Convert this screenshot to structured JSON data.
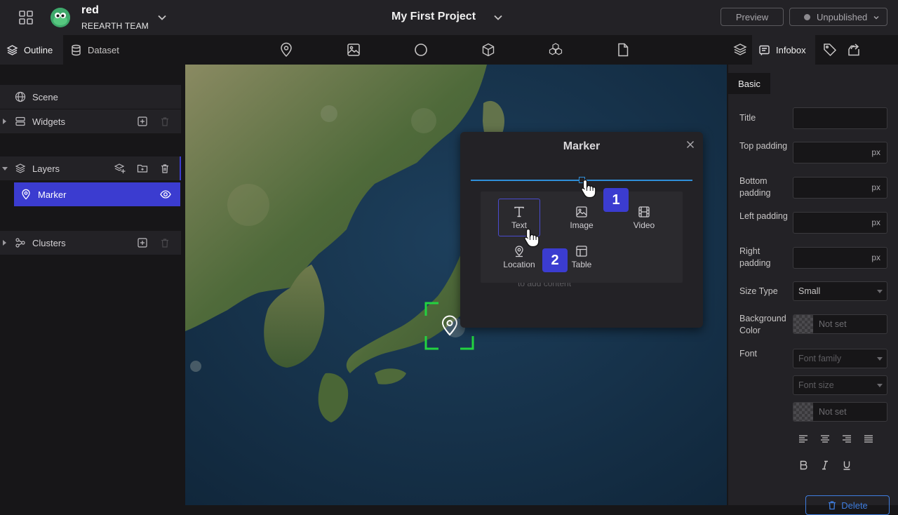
{
  "workspace": {
    "name": "red",
    "team": "REEARTH TEAM"
  },
  "project": {
    "title": "My First Project"
  },
  "header": {
    "preview_label": "Preview",
    "publish_status": "Unpublished"
  },
  "left_tabs": {
    "outline": "Outline",
    "dataset": "Dataset"
  },
  "toolbar": {
    "tools": [
      "marker-icon",
      "image-icon",
      "sphere-icon",
      "polygon-icon",
      "model-icon",
      "file-icon"
    ]
  },
  "right_tabs": {
    "infobox": "Infobox"
  },
  "outline": {
    "scene": "Scene",
    "widgets": "Widgets",
    "layers": "Layers",
    "marker": "Marker",
    "clusters": "Clusters"
  },
  "popup": {
    "title": "Marker",
    "hint": "to add content",
    "blocks": {
      "text": "Text",
      "image": "Image",
      "video": "Video",
      "location": "Location",
      "table": "Table"
    },
    "badges": {
      "one": "1",
      "two": "2"
    }
  },
  "infobox": {
    "tab_basic": "Basic",
    "title_label": "Title",
    "top_padding_label": "Top padding",
    "bottom_padding_label": "Bottom padding",
    "left_padding_label": "Left padding",
    "right_padding_label": "Right padding",
    "unit": "px",
    "size_type_label": "Size Type",
    "size_type_value": "Small",
    "bg_color_label": "Background Color",
    "not_set": "Not set",
    "font_label": "Font",
    "font_family_placeholder": "Font family",
    "font_size_placeholder": "Font size",
    "delete_label": "Delete"
  },
  "colors": {
    "accent": "#3b3cd0",
    "slider": "#2f8fd8",
    "selection": "#22d340",
    "delete": "#3f7ee0"
  }
}
